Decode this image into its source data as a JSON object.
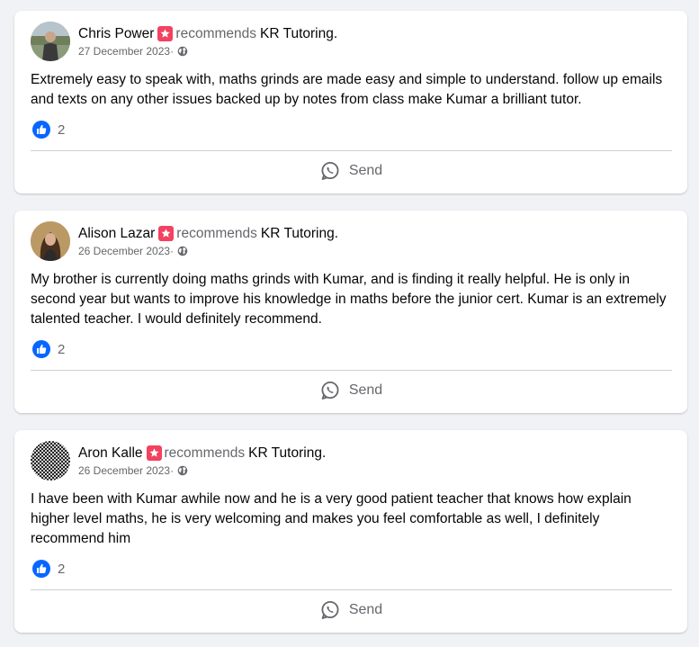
{
  "colors": {
    "background": "#f0f2f5",
    "card": "#ffffff",
    "recommend_badge": "#f3425f",
    "like_blue": "#0866ff",
    "secondary_text": "#65676b"
  },
  "reviews": [
    {
      "author": "Chris Power",
      "recommends_text": "recommends",
      "page": "KR Tutoring",
      "period": ".",
      "date": "27 December 2023",
      "date_sep": "·",
      "privacy_icon": "globe-icon",
      "text": "Extremely easy to speak with, maths grinds are made easy and simple to understand. follow up emails and texts on any other issues backed up by notes from class make Kumar a brilliant tutor.",
      "likes": "2",
      "send_label": "Send"
    },
    {
      "author": "Alison Lazar",
      "recommends_text": "recommends",
      "page": "KR Tutoring",
      "period": ".",
      "date": "26 December 2023",
      "date_sep": "·",
      "privacy_icon": "globe-icon",
      "text": "My brother is currently doing maths grinds with Kumar, and is finding it really helpful. He is only in second year but wants to improve his knowledge in maths before the junior cert. Kumar is an extremely talented teacher. I would definitely recommend.",
      "likes": "2",
      "send_label": "Send"
    },
    {
      "author": "Aron Kalle",
      "recommends_text": "recommends",
      "page": "KR Tutoring",
      "period": ".",
      "date": "26 December 2023",
      "date_sep": "·",
      "privacy_icon": "globe-icon",
      "text": "I have been with Kumar awhile now and he is a very good patient teacher that knows how explain higher level maths, he is very welcoming and makes you feel comfortable as well, I definitely recommend him",
      "likes": "2",
      "send_label": "Send"
    }
  ]
}
